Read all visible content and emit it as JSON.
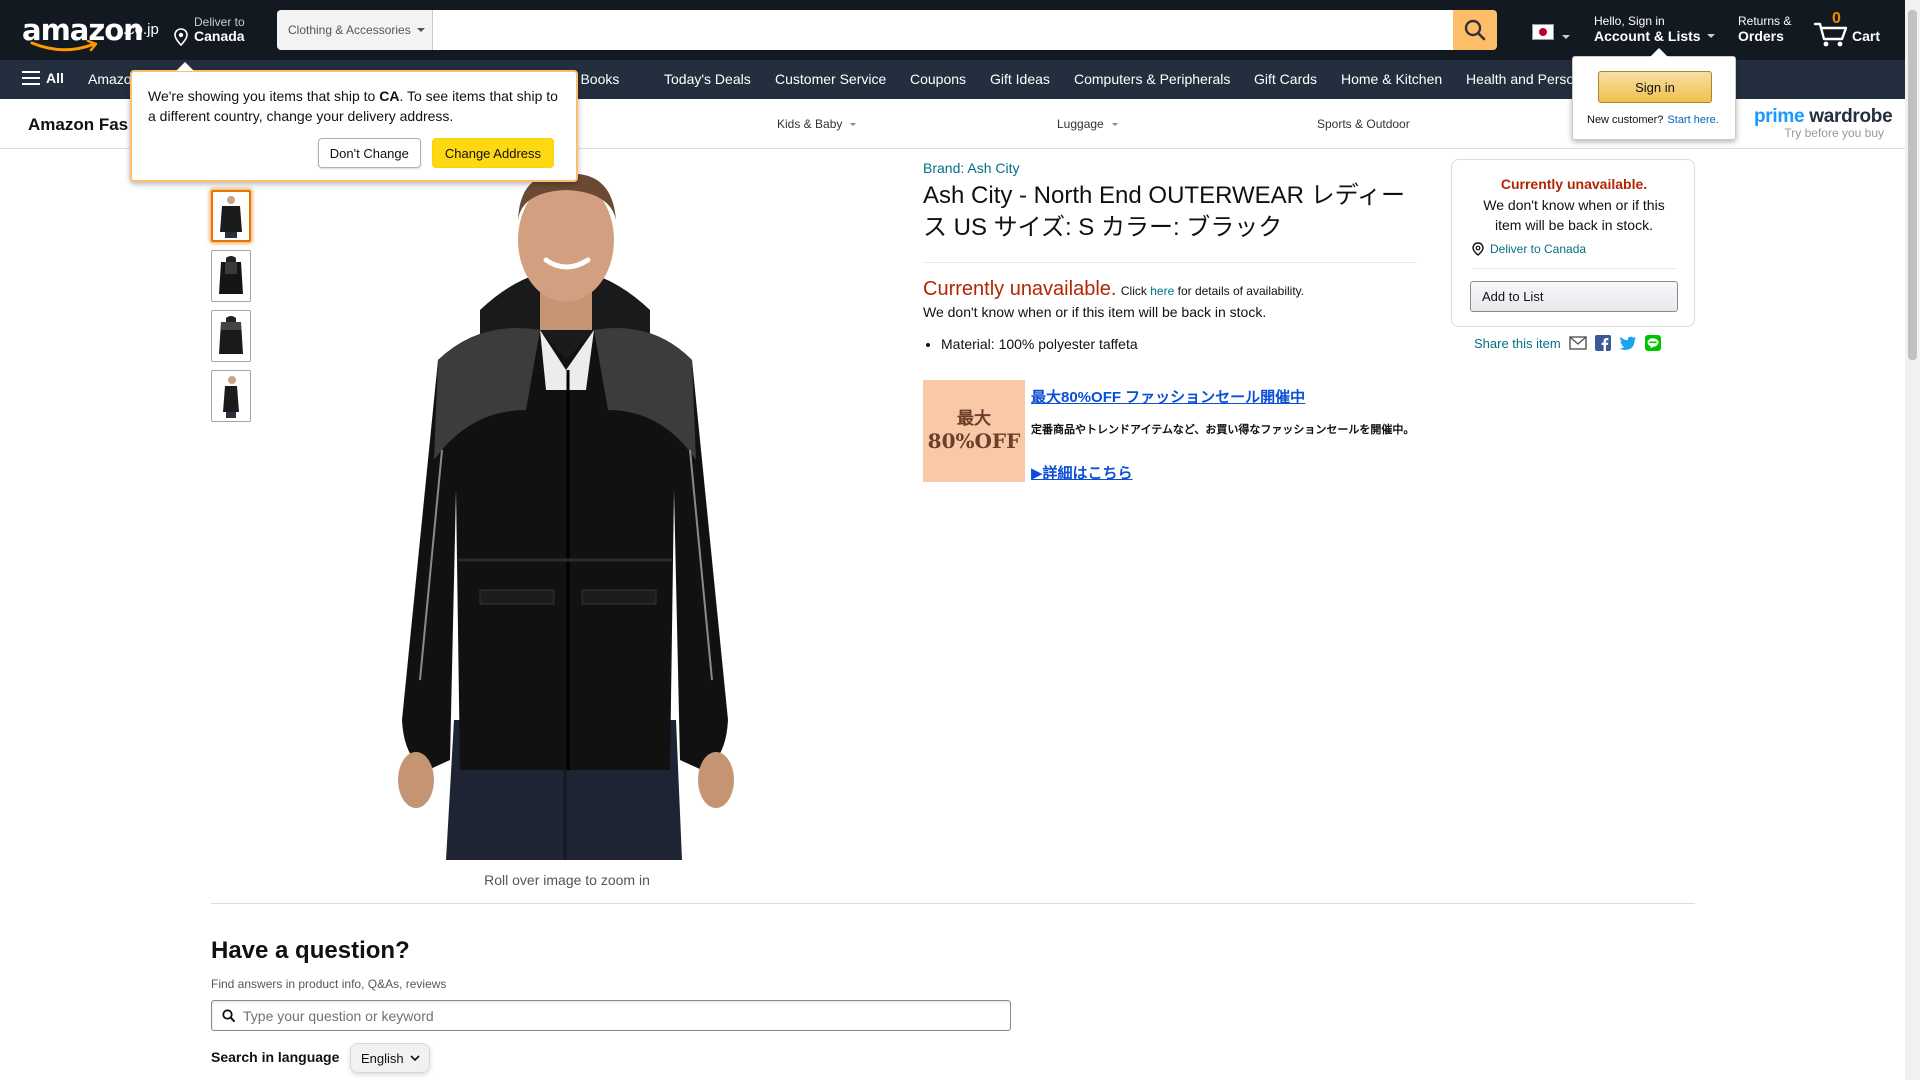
{
  "header": {
    "logo_text": "amazon",
    "logo_tld": ".co.jp",
    "deliver_line1": "Deliver to",
    "deliver_line2": "Canada",
    "search_category": "Clothing & Accessories",
    "search_value": "",
    "account_line1": "Hello, Sign in",
    "account_line2": "Account & Lists",
    "returns_line1": "Returns &",
    "returns_line2": "Orders",
    "cart_count": "0",
    "cart_label": "Cart",
    "icons": [
      "location-pin-icon",
      "search-icon",
      "japan-flag-icon",
      "cart-icon"
    ]
  },
  "nav": {
    "all_label": "All",
    "links": [
      "Amazo",
      "ese Books",
      "Today's Deals",
      "Customer Service",
      "Coupons",
      "Gift Ideas",
      "Computers & Peripherals",
      "Gift Cards",
      "Home & Kitchen",
      "Health and Perso"
    ]
  },
  "fashion_bar": {
    "title": "Amazon Fas",
    "items": [
      "Kids & Baby",
      "Luggage",
      "Sports & Outdoor"
    ],
    "prime_wardrobe_prime": "prime",
    "prime_wardrobe_wardrobe": "wardrobe",
    "prime_wardrobe_sub": "Try before you buy"
  },
  "ship_popover": {
    "text_before": "We're showing you items that ship to ",
    "country": "CA",
    "text_after": ". To see items that ship to a different country, change your delivery address.",
    "dont_change": "Don't Change",
    "change_address": "Change Address"
  },
  "signin_popover": {
    "button": "Sign in",
    "new_customer": "New customer?",
    "start_here": "Start here."
  },
  "product": {
    "brand": "Brand: Ash City",
    "title": "Ash City - North End OUTERWEAR レディース US サイズ: S カラー: ブラック",
    "unavailable": "Currently unavailable.",
    "click": "Click",
    "here": "here",
    "details": "for details of availability.",
    "note": "We don't know when or if this item will be back in stock.",
    "bullets": [
      "Material: 100% polyester taffeta"
    ],
    "zoom_hint": "Roll over image to zoom in"
  },
  "promo": {
    "badge_line1": "最大",
    "badge_line2": "80%OFF",
    "title": "最大80%OFF ファッションセール開催中",
    "description": "定番商品やトレンドアイテムなど、お買い得なファッションセールを開催中。",
    "link": "▶詳細はこちら"
  },
  "buybox": {
    "unavailable": "Currently unavailable.",
    "note": "We don't know when or if this item will be back in stock.",
    "deliver": "Deliver to Canada",
    "add_to_list": "Add to List"
  },
  "share": {
    "label": "Share this item",
    "icons": [
      "email-icon",
      "facebook-icon",
      "twitter-icon",
      "line-icon"
    ]
  },
  "qa": {
    "title": "Have a question?",
    "subtitle": "Find answers in product info, Q&As, reviews",
    "placeholder": "Type your question or keyword",
    "language_label": "Search in language",
    "language_value": "English"
  },
  "colors": {
    "header_bg": "#131921",
    "nav_bg": "#232f3e",
    "search_button": "#febd69",
    "unavailable_red": "#b12704",
    "link_teal": "#007185",
    "cart_count_orange": "#f08804"
  }
}
